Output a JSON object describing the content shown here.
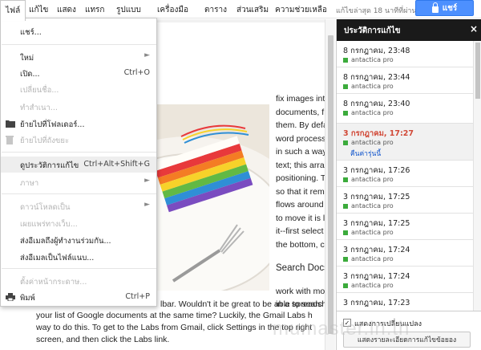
{
  "menubar": {
    "items": [
      "ไฟล์",
      "แก้ไข",
      "แสดง",
      "แทรก",
      "รูปแบบ",
      "เครื่องมือ",
      "ตาราง",
      "ส่วนเสริม",
      "ความช่วยเหลือ"
    ],
    "last_edit": "แก้ไขล่าสุด 18 นาทีที่ผ่านมา",
    "share_label": "แชร์"
  },
  "file_menu": {
    "share": "แชร์...",
    "new": "ใหม่",
    "open": "เปิด...",
    "open_shortcut": "Ctrl+O",
    "rename": "เปลี่ยนชื่อ...",
    "make_copy": "ทำสำเนา...",
    "move_to_folder": "ย้ายไปที่โฟลเดอร์...",
    "move_to_trash": "ย้ายไปที่ถังขยะ",
    "revision_history": "ดูประวัติการแก้ไข",
    "revision_shortcut": "Ctrl+Alt+Shift+G",
    "language": "ภาษา",
    "download_as": "ดาวน์โหลดเป็น",
    "publish": "เผยแพร่ทางเว็บ...",
    "email_collaborators": "ส่งอีเมลถึงผู้ทำงานร่วมกัน...",
    "email_attachment": "ส่งอีเมลเป็นไฟล์แนบ...",
    "page_setup": "ตั้งค่าหน้ากระดาษ...",
    "print": "พิมพ์",
    "print_shortcut": "Ctrl+P"
  },
  "document": {
    "right_col": [
      "fix images int",
      "documents, f",
      "them. By defa",
      "word process",
      "in such a way",
      "text; this arra",
      "positioning. T",
      "so that it rem",
      "flows around",
      "to move it is l",
      "it--first select",
      "the bottom, c"
    ],
    "search_heading": "Search Docs",
    "after_lines": [
      "work with mo",
      "in a spreadsh"
    ],
    "bottom_lines": [
      "lbar. Wouldn't it be great to be able to searc",
      "your list of Google documents at the same time? Luckily, the Gmail Labs h",
      "way to do this. To get to the Labs from Gmail, click Settings in the top right",
      "screen, and then click the Labs link."
    ]
  },
  "revision_panel": {
    "title": "ประวัติการแก้ไข",
    "author": "antactica pro",
    "restore_label": "คืนค่ารุ่นนี้",
    "revisions": [
      "8 กรกฎาคม, 23:48",
      "8 กรกฎาคม, 23:44",
      "8 กรกฎาคม, 23:40",
      "3 กรกฎาคม, 17:27",
      "3 กรกฎาคม, 17:26",
      "3 กรกฎาคม, 17:25",
      "3 กรกฎาคม, 17:25",
      "3 กรกฎาคม, 17:24",
      "3 กรกฎาคม, 17:24",
      "3 กรกฎาคม, 17:23"
    ],
    "show_changes_label": "แสดงการเปลี่ยนแปลง",
    "detailed_button": "แสดงรายละเอียดการแก้ไขข้อยอง"
  },
  "watermark": "mumaster.in.th",
  "colors": {
    "share_blue": "#4d90fe",
    "selected_revision": "#d14836",
    "panel_header": "#1a1a1a",
    "author_green": "#3cab3c"
  }
}
